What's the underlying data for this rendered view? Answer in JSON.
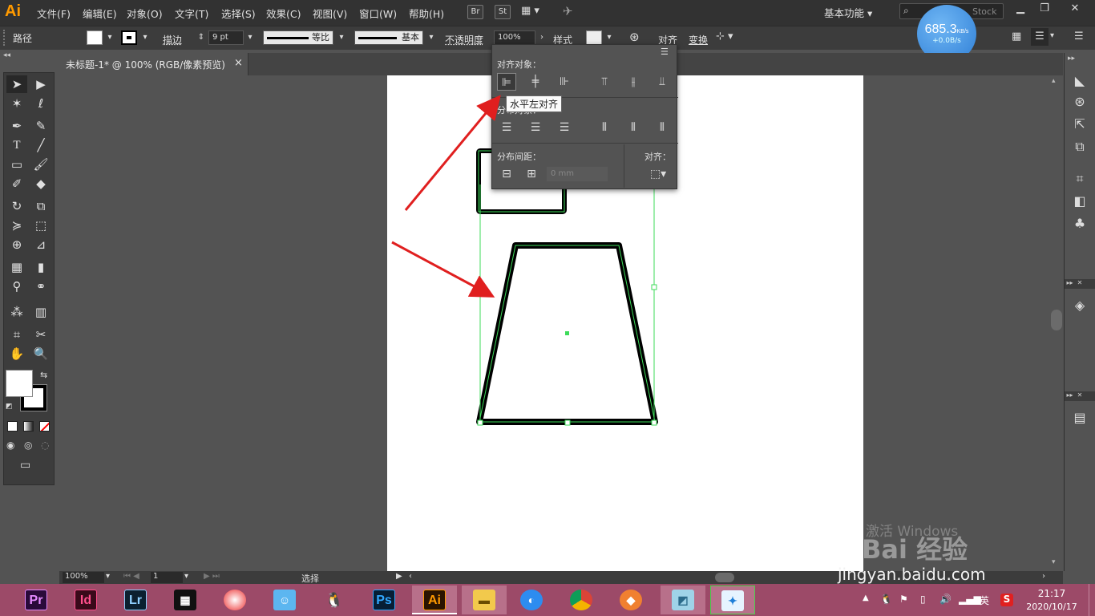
{
  "app": {
    "logo": "Ai"
  },
  "menu": [
    "文件(F)",
    "编辑(E)",
    "对象(O)",
    "文字(T)",
    "选择(S)",
    "效果(C)",
    "视图(V)",
    "窗口(W)",
    "帮助(H)"
  ],
  "bridge_buttons": [
    "Br",
    "St"
  ],
  "workspace": "基本功能",
  "search": {
    "placeholder": "搜索 Adobe Stock",
    "suffix": "Stock"
  },
  "speed_widget": {
    "value": "685.3",
    "unit": "KB/s",
    "sub": "+0.0B/s"
  },
  "controlbar": {
    "selection_type": "路径",
    "stroke_label": "描边",
    "stroke_weight": "9 pt",
    "profile_label": "等比",
    "brush_label": "基本",
    "opacity_label": "不透明度",
    "opacity_value": "100%",
    "style_label": "样式",
    "align_label": "对齐",
    "transform_label": "变换"
  },
  "document_tab": {
    "title": "未标题-1* @ 100% (RGB/像素预览)",
    "close": "×"
  },
  "align_panel": {
    "align_objects_label": "对齐对象：",
    "distribute_objects_label": "分布对象：",
    "distribute_spacing_label": "分布间距：",
    "align_to_label": "对齐：",
    "spacing_value": "0 mm",
    "tooltip": "水平左对齐"
  },
  "statusbar": {
    "zoom": "100%",
    "artboard_number": "1",
    "tool_label": "选择"
  },
  "watermark": {
    "activation": "激活 Windows",
    "baidu": "Bai 经验",
    "url": "jingyan.baidu.com"
  },
  "taskbar": {
    "apps": [
      {
        "name": "Pr",
        "bg": "#2a0a3a",
        "fg": "#e58cff"
      },
      {
        "name": "Id",
        "bg": "#3a0a1a",
        "fg": "#ff4f8c"
      },
      {
        "name": "Lr",
        "bg": "#0b2030",
        "fg": "#8fd0ff"
      },
      {
        "name": "Ps",
        "bg": "#061e35",
        "fg": "#31a8ff"
      },
      {
        "name": "Ai",
        "bg": "#2b1400",
        "fg": "#ff9a00"
      }
    ],
    "time": "21:17",
    "date": "2020/10/17",
    "ime": "英"
  },
  "colors": {
    "menubar": "#323232",
    "panel": "#535353",
    "taskbar": "#9c4a68",
    "selection": "#3ddb5a",
    "arrow": "#e01f1f"
  }
}
